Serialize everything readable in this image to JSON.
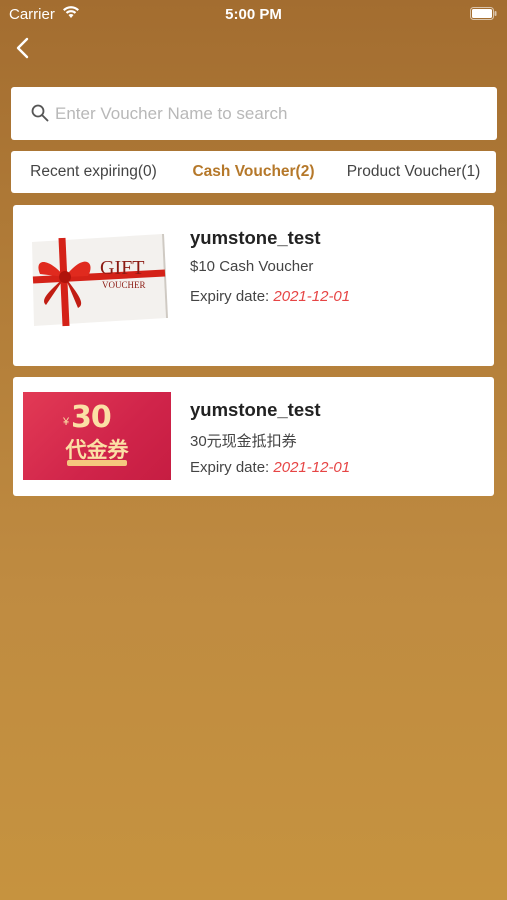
{
  "status_bar": {
    "carrier": "Carrier",
    "time": "5:00 PM"
  },
  "search": {
    "placeholder": "Enter Voucher Name to search",
    "value": ""
  },
  "tabs": [
    {
      "label": "Recent expiring(0)",
      "active": false
    },
    {
      "label": "Cash Voucher(2)",
      "active": true
    },
    {
      "label": "Product Voucher(1)",
      "active": false
    }
  ],
  "vouchers": [
    {
      "image": "gift-voucher",
      "image_text": [
        "GIFT",
        "VOUCHER"
      ],
      "title": "yumstone_test",
      "desc": "$10 Cash Voucher",
      "expiry_label": "Expiry date:",
      "expiry_date": "2021-12-01"
    },
    {
      "image": "cash-coupon-30",
      "image_text": [
        "¥",
        "30",
        "代金券"
      ],
      "title": "yumstone_test",
      "desc": "30元现金抵扣券",
      "expiry_label": "Expiry date:",
      "expiry_date": "2021-12-01"
    }
  ],
  "colors": {
    "accent": "#b5782a",
    "expiry": "#e64545",
    "background_top": "#a36d30",
    "background_bottom": "#c6933f"
  }
}
